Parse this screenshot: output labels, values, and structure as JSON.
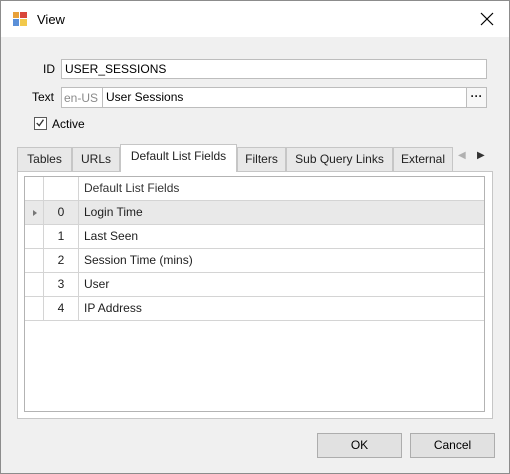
{
  "window": {
    "title": "View",
    "icon": "form-icon"
  },
  "form": {
    "id_label": "ID",
    "id_value": "USER_SESSIONS",
    "text_label": "Text",
    "text_locale": "en-US",
    "text_value": "User Sessions",
    "ellipsis_label": "···",
    "active_label": "Active",
    "active_checked": true
  },
  "tabs": [
    {
      "label": "Tables",
      "active": false
    },
    {
      "label": "URLs",
      "active": false
    },
    {
      "label": "Default List Fields",
      "active": true
    },
    {
      "label": "Filters",
      "active": false
    },
    {
      "label": "Sub Query Links",
      "active": false
    },
    {
      "label": "External",
      "active": false
    }
  ],
  "grid": {
    "column_header": "Default List Fields",
    "rows": [
      {
        "num": "0",
        "label": "Login Time",
        "selected": true
      },
      {
        "num": "1",
        "label": "Last Seen",
        "selected": false
      },
      {
        "num": "2",
        "label": "Session Time (mins)",
        "selected": false
      },
      {
        "num": "3",
        "label": "User",
        "selected": false
      },
      {
        "num": "4",
        "label": "IP Address",
        "selected": false
      }
    ]
  },
  "buttons": {
    "ok": "OK",
    "cancel": "Cancel"
  }
}
